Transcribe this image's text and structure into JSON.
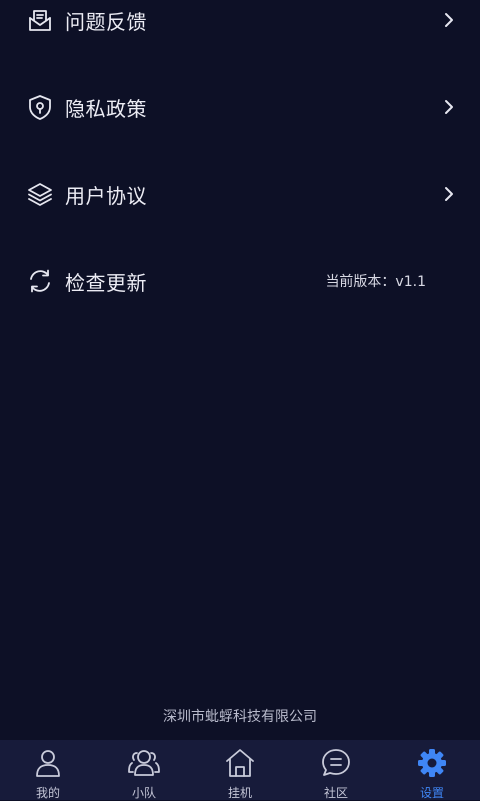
{
  "settings": {
    "items": [
      {
        "label": "问题反馈",
        "icon": "mail-feedback-icon",
        "has_arrow": true
      },
      {
        "label": "隐私政策",
        "icon": "shield-lock-icon",
        "has_arrow": true
      },
      {
        "label": "用户协议",
        "icon": "layers-icon",
        "has_arrow": true
      },
      {
        "label": "检查更新",
        "icon": "refresh-icon",
        "has_arrow": false,
        "value": "当前版本：v1.1"
      }
    ]
  },
  "footer": {
    "company": "深圳市蚍蜉科技有限公司"
  },
  "tabbar": {
    "tabs": [
      {
        "label": "我的",
        "icon": "user-icon",
        "active": false
      },
      {
        "label": "小队",
        "icon": "team-icon",
        "active": false
      },
      {
        "label": "挂机",
        "icon": "home-icon",
        "active": false
      },
      {
        "label": "社区",
        "icon": "chat-icon",
        "active": false
      },
      {
        "label": "设置",
        "icon": "gear-icon",
        "active": true
      }
    ]
  },
  "colors": {
    "background": "#0d1026",
    "tabbar_background": "#171b3a",
    "accent": "#3f86f5",
    "text": "#ececf4"
  }
}
